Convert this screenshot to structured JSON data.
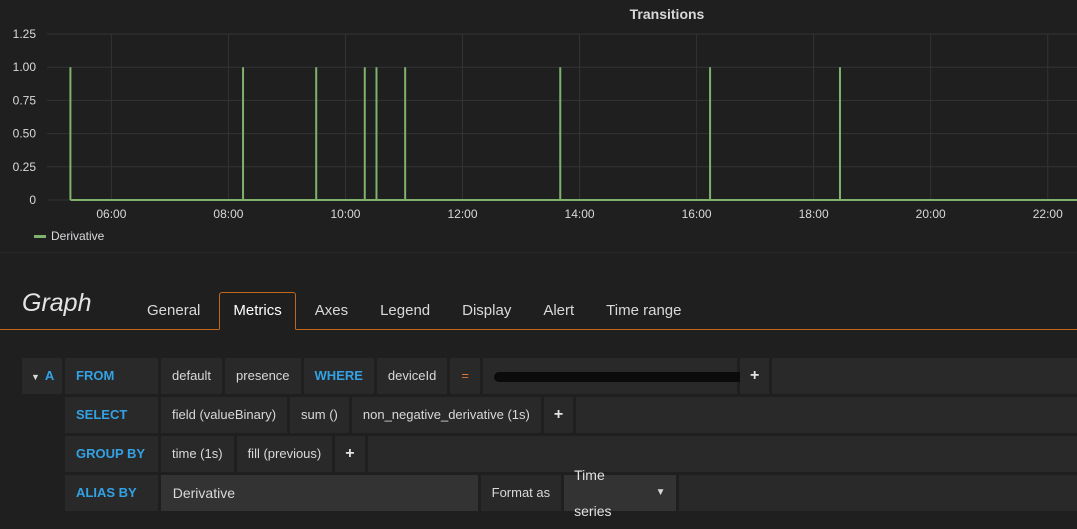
{
  "panel": {
    "title": "Transitions",
    "legend": {
      "label": "Derivative",
      "color": "#7eb26d"
    }
  },
  "chart_data": {
    "type": "line",
    "title": "Transitions",
    "xlabel": "",
    "ylabel": "",
    "x_ticks": [
      "06:00",
      "08:00",
      "10:00",
      "12:00",
      "14:00",
      "16:00",
      "18:00",
      "20:00",
      "22:00"
    ],
    "y_ticks": [
      "0",
      "0.25",
      "0.50",
      "0.75",
      "1.00",
      "1.25"
    ],
    "ylim": [
      0,
      1.25
    ],
    "xlim_hours": [
      4.9,
      22.5
    ],
    "grid": true,
    "legend_position": "bottom-left",
    "series": [
      {
        "name": "Derivative",
        "color": "#7eb26d",
        "baseline_start_hour": 5.3,
        "spike_value": 1,
        "spike_hours": [
          5.3,
          8.25,
          9.5,
          10.33,
          10.53,
          11.02,
          13.67,
          16.23,
          18.45
        ]
      }
    ]
  },
  "editor": {
    "title": "Graph",
    "tabs": [
      {
        "label": "General",
        "active": false
      },
      {
        "label": "Metrics",
        "active": true
      },
      {
        "label": "Axes",
        "active": false
      },
      {
        "label": "Legend",
        "active": false
      },
      {
        "label": "Display",
        "active": false
      },
      {
        "label": "Alert",
        "active": false
      },
      {
        "label": "Time range",
        "active": false
      }
    ],
    "query": {
      "ref_id": "A",
      "collapse_icon": "caret-down-icon",
      "from_kw": "FROM",
      "policy": "default",
      "measurement": "presence",
      "where_kw": "WHERE",
      "where_key": "deviceId",
      "where_op": "=",
      "select_kw": "SELECT",
      "select_parts": [
        "field (valueBinary)",
        "sum ()",
        "non_negative_derivative (1s)"
      ],
      "group_kw": "GROUP BY",
      "group_parts": [
        "time (1s)",
        "fill (previous)"
      ],
      "alias_kw": "ALIAS BY",
      "alias_value": "Derivative",
      "format_label": "Format as",
      "format_value": "Time series",
      "plus": "+"
    }
  }
}
